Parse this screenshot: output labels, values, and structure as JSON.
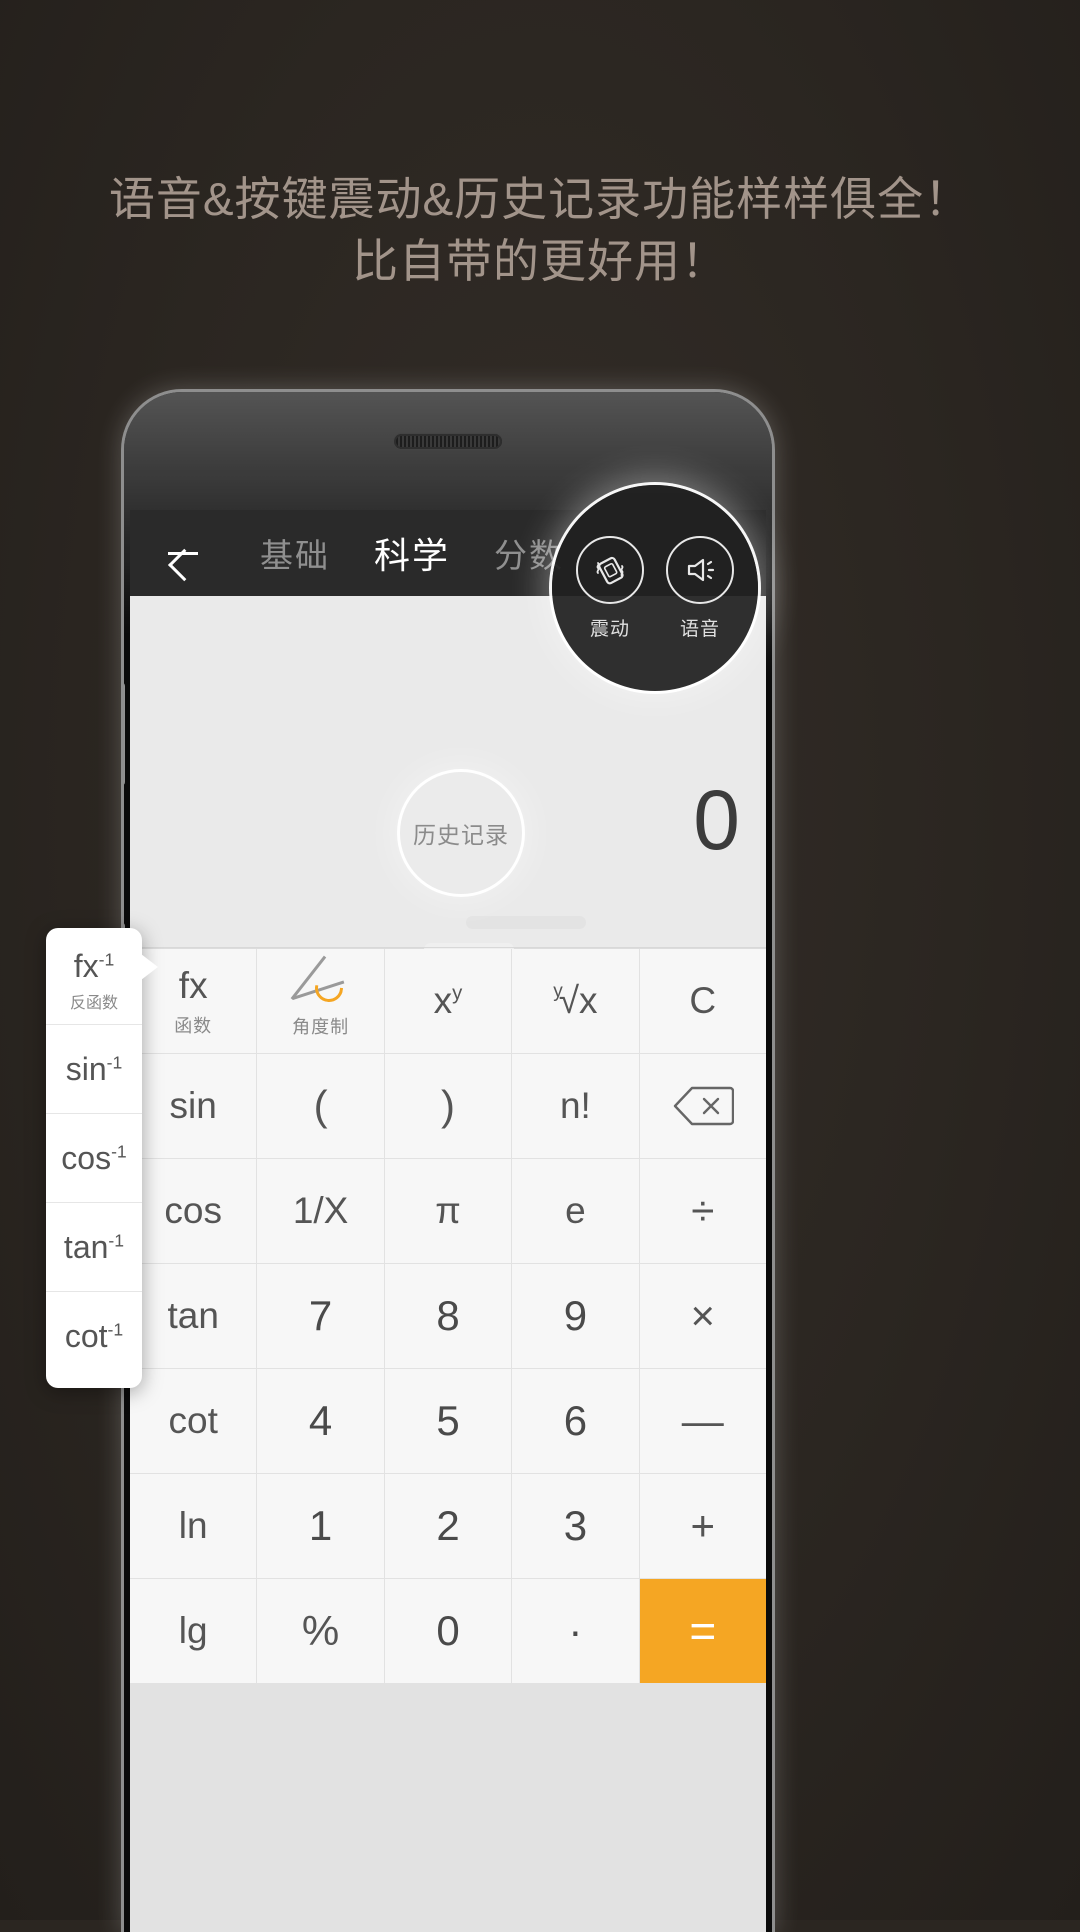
{
  "promo": {
    "line1": "语音&按键震动&历史记录功能样样俱全！",
    "line2": "比自带的更好用！",
    "text_color": "#a2948a",
    "background_color": "#2b2621"
  },
  "app": {
    "navbar": {
      "back_icon": "back-arrow-icon",
      "tabs": [
        {
          "label": "基础",
          "active": false
        },
        {
          "label": "科学",
          "active": true
        },
        {
          "label": "分数",
          "active": false
        }
      ]
    },
    "display": {
      "value": "0"
    },
    "highlight_tools": {
      "items": [
        {
          "icon": "vibrate-icon",
          "label": "震动"
        },
        {
          "icon": "speaker-icon",
          "label": "语音"
        }
      ]
    },
    "history_spotlight": {
      "label": "历史记录"
    },
    "fx_popup": {
      "items": [
        {
          "label": "fx",
          "sup": "-1",
          "sub": "反函数"
        },
        {
          "label": "sin",
          "sup": "-1",
          "sub": ""
        },
        {
          "label": "cos",
          "sup": "-1",
          "sub": ""
        },
        {
          "label": "tan",
          "sup": "-1",
          "sub": ""
        },
        {
          "label": "cot",
          "sup": "-1",
          "sub": ""
        }
      ]
    },
    "keypad": {
      "accent_color": "#f5a623",
      "rows": [
        [
          {
            "label": "fx",
            "sub": "函数",
            "type": "fn"
          },
          {
            "label": "",
            "sub": "角度制",
            "type": "angle"
          },
          {
            "label": "x",
            "sup": "y",
            "sub": "",
            "type": "pow"
          },
          {
            "label": "√x",
            "idx": "y",
            "sub": "",
            "type": "root"
          },
          {
            "label": "C",
            "sub": "",
            "type": "clear"
          }
        ],
        [
          {
            "label": "sin",
            "sub": "",
            "type": "fn"
          },
          {
            "label": "(",
            "sub": "",
            "type": "op"
          },
          {
            "label": ")",
            "sub": "",
            "type": "op"
          },
          {
            "label": "n!",
            "sub": "",
            "type": "fn"
          },
          {
            "label": "",
            "sub": "",
            "type": "backspace"
          }
        ],
        [
          {
            "label": "cos",
            "sub": "",
            "type": "fn"
          },
          {
            "label": "1/X",
            "sub": "",
            "type": "fn"
          },
          {
            "label": "π",
            "sub": "",
            "type": "const"
          },
          {
            "label": "e",
            "sub": "",
            "type": "const"
          },
          {
            "label": "÷",
            "sub": "",
            "type": "op"
          }
        ],
        [
          {
            "label": "tan",
            "sub": "",
            "type": "fn"
          },
          {
            "label": "7",
            "sub": "",
            "type": "num"
          },
          {
            "label": "8",
            "sub": "",
            "type": "num"
          },
          {
            "label": "9",
            "sub": "",
            "type": "num"
          },
          {
            "label": "×",
            "sub": "",
            "type": "op"
          }
        ],
        [
          {
            "label": "cot",
            "sub": "",
            "type": "fn"
          },
          {
            "label": "4",
            "sub": "",
            "type": "num"
          },
          {
            "label": "5",
            "sub": "",
            "type": "num"
          },
          {
            "label": "6",
            "sub": "",
            "type": "num"
          },
          {
            "label": "—",
            "sub": "",
            "type": "op"
          }
        ],
        [
          {
            "label": "ln",
            "sub": "",
            "type": "fn"
          },
          {
            "label": "1",
            "sub": "",
            "type": "num"
          },
          {
            "label": "2",
            "sub": "",
            "type": "num"
          },
          {
            "label": "3",
            "sub": "",
            "type": "num"
          },
          {
            "label": "+",
            "sub": "",
            "type": "op"
          }
        ],
        [
          {
            "label": "lg",
            "sub": "",
            "type": "fn"
          },
          {
            "label": "%",
            "sub": "",
            "type": "op"
          },
          {
            "label": "0",
            "sub": "",
            "type": "num"
          },
          {
            "label": "·",
            "sub": "",
            "type": "num"
          },
          {
            "label": "=",
            "sub": "",
            "type": "equals"
          }
        ]
      ]
    }
  }
}
